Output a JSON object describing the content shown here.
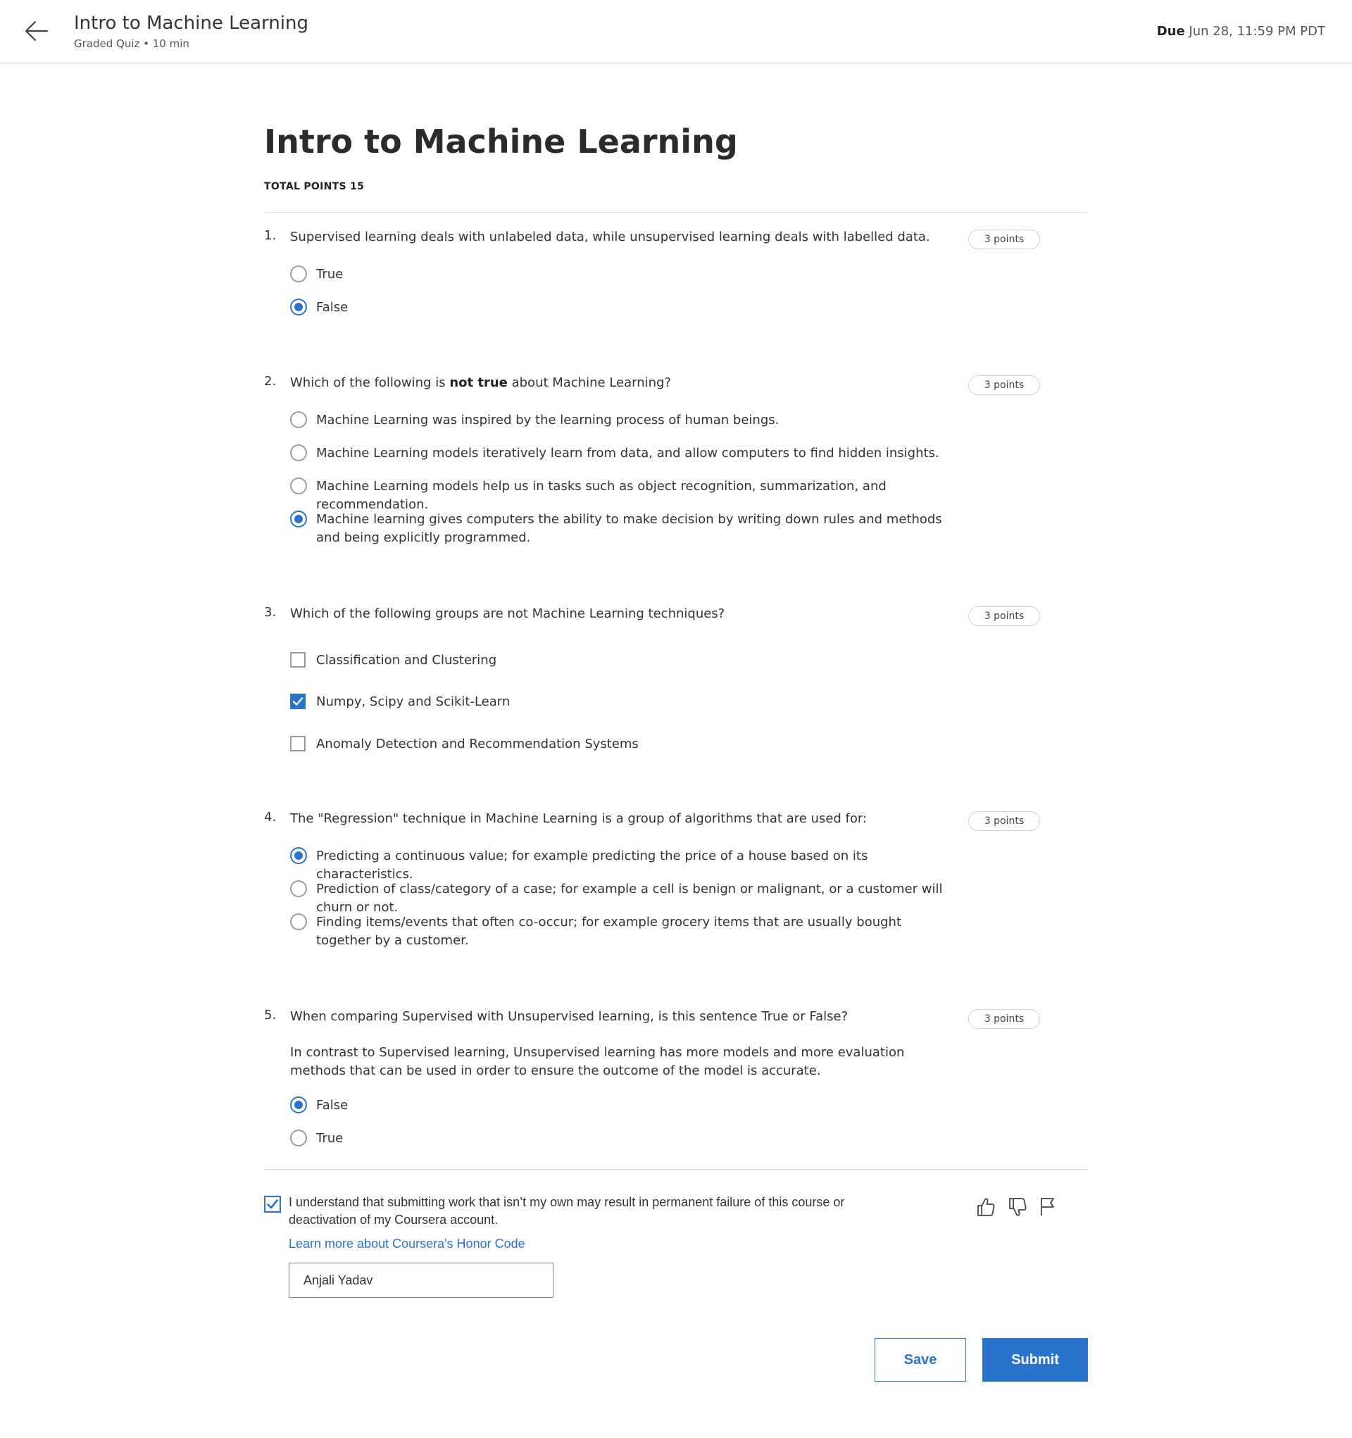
{
  "header": {
    "title": "Intro to Machine Learning",
    "subtitle": "Graded Quiz • 10 min",
    "due_label": "Due",
    "due_value": "Jun 28, 11:59 PM PDT",
    "back_icon": "arrow-left-icon"
  },
  "quiz": {
    "title": "Intro to Machine Learning",
    "total_points": "TOTAL POINTS 15"
  },
  "questions": [
    {
      "number": "1.",
      "text": "Supervised learning deals with unlabeled data, while unsupervised learning deals with labelled data.",
      "points": "3 points",
      "type": "radio",
      "options": [
        {
          "label": "True",
          "selected": false
        },
        {
          "label": "False",
          "selected": true
        }
      ]
    },
    {
      "number": "2.",
      "text_before": "Which of the following is ",
      "text_bold": "not true",
      "text_after": " about Machine Learning?",
      "points": "3 points",
      "type": "radio",
      "options": [
        {
          "label": "Machine Learning was inspired by the learning process of human beings.",
          "selected": false
        },
        {
          "label": "Machine Learning models iteratively learn from data, and allow computers to find hidden insights.",
          "selected": false
        },
        {
          "label": "Machine Learning models help us in tasks such as object recognition, summarization, and recommendation.",
          "selected": false
        },
        {
          "label": "Machine learning gives computers the ability to make decision by writing down rules and methods and being explicitly programmed.",
          "selected": true
        }
      ]
    },
    {
      "number": "3.",
      "text": "Which of the following groups are not Machine Learning techniques?",
      "points": "3 points",
      "type": "checkbox",
      "options": [
        {
          "label": "Classification and Clustering",
          "selected": false
        },
        {
          "label": "Numpy, Scipy and Scikit-Learn",
          "selected": true
        },
        {
          "label": "Anomaly Detection and Recommendation Systems",
          "selected": false
        }
      ]
    },
    {
      "number": "4.",
      "text": "The \"Regression\" technique in Machine Learning is a group of algorithms that are used for:",
      "points": "3 points",
      "type": "radio",
      "options": [
        {
          "label": "Predicting a continuous value; for example predicting the price of a house based on its characteristics.",
          "selected": true
        },
        {
          "label": "Prediction of class/category of a case; for example a cell is benign or malignant, or a customer will churn or not.",
          "selected": false
        },
        {
          "label": "Finding items/events that often co-occur; for example grocery items that are usually bought together by a customer.",
          "selected": false
        }
      ]
    },
    {
      "number": "5.",
      "text": "When comparing Supervised with Unsupervised learning, is this sentence True or False?",
      "statement": "In contrast to Supervised learning, Unsupervised learning has more models and more evaluation methods that can be used in order to ensure the outcome of the model is accurate.",
      "points": "3 points",
      "type": "radio",
      "options": [
        {
          "label": "False",
          "selected": true
        },
        {
          "label": "True",
          "selected": false
        }
      ]
    }
  ],
  "honor": {
    "checked": true,
    "text": "I understand that submitting work that isn’t my own may result in permanent failure of this course or deactivation of my Coursera account.",
    "link": "Learn more about Coursera's Honor Code",
    "name_value": "Anjali Yadav"
  },
  "feedback": {
    "like_icon": "thumbs-up-icon",
    "dislike_icon": "thumbs-down-icon",
    "flag_icon": "flag-icon"
  },
  "actions": {
    "save_label": "Save",
    "submit_label": "Submit"
  },
  "colors": {
    "accent": "#2a73cc",
    "divider": "#dcdcdc"
  }
}
